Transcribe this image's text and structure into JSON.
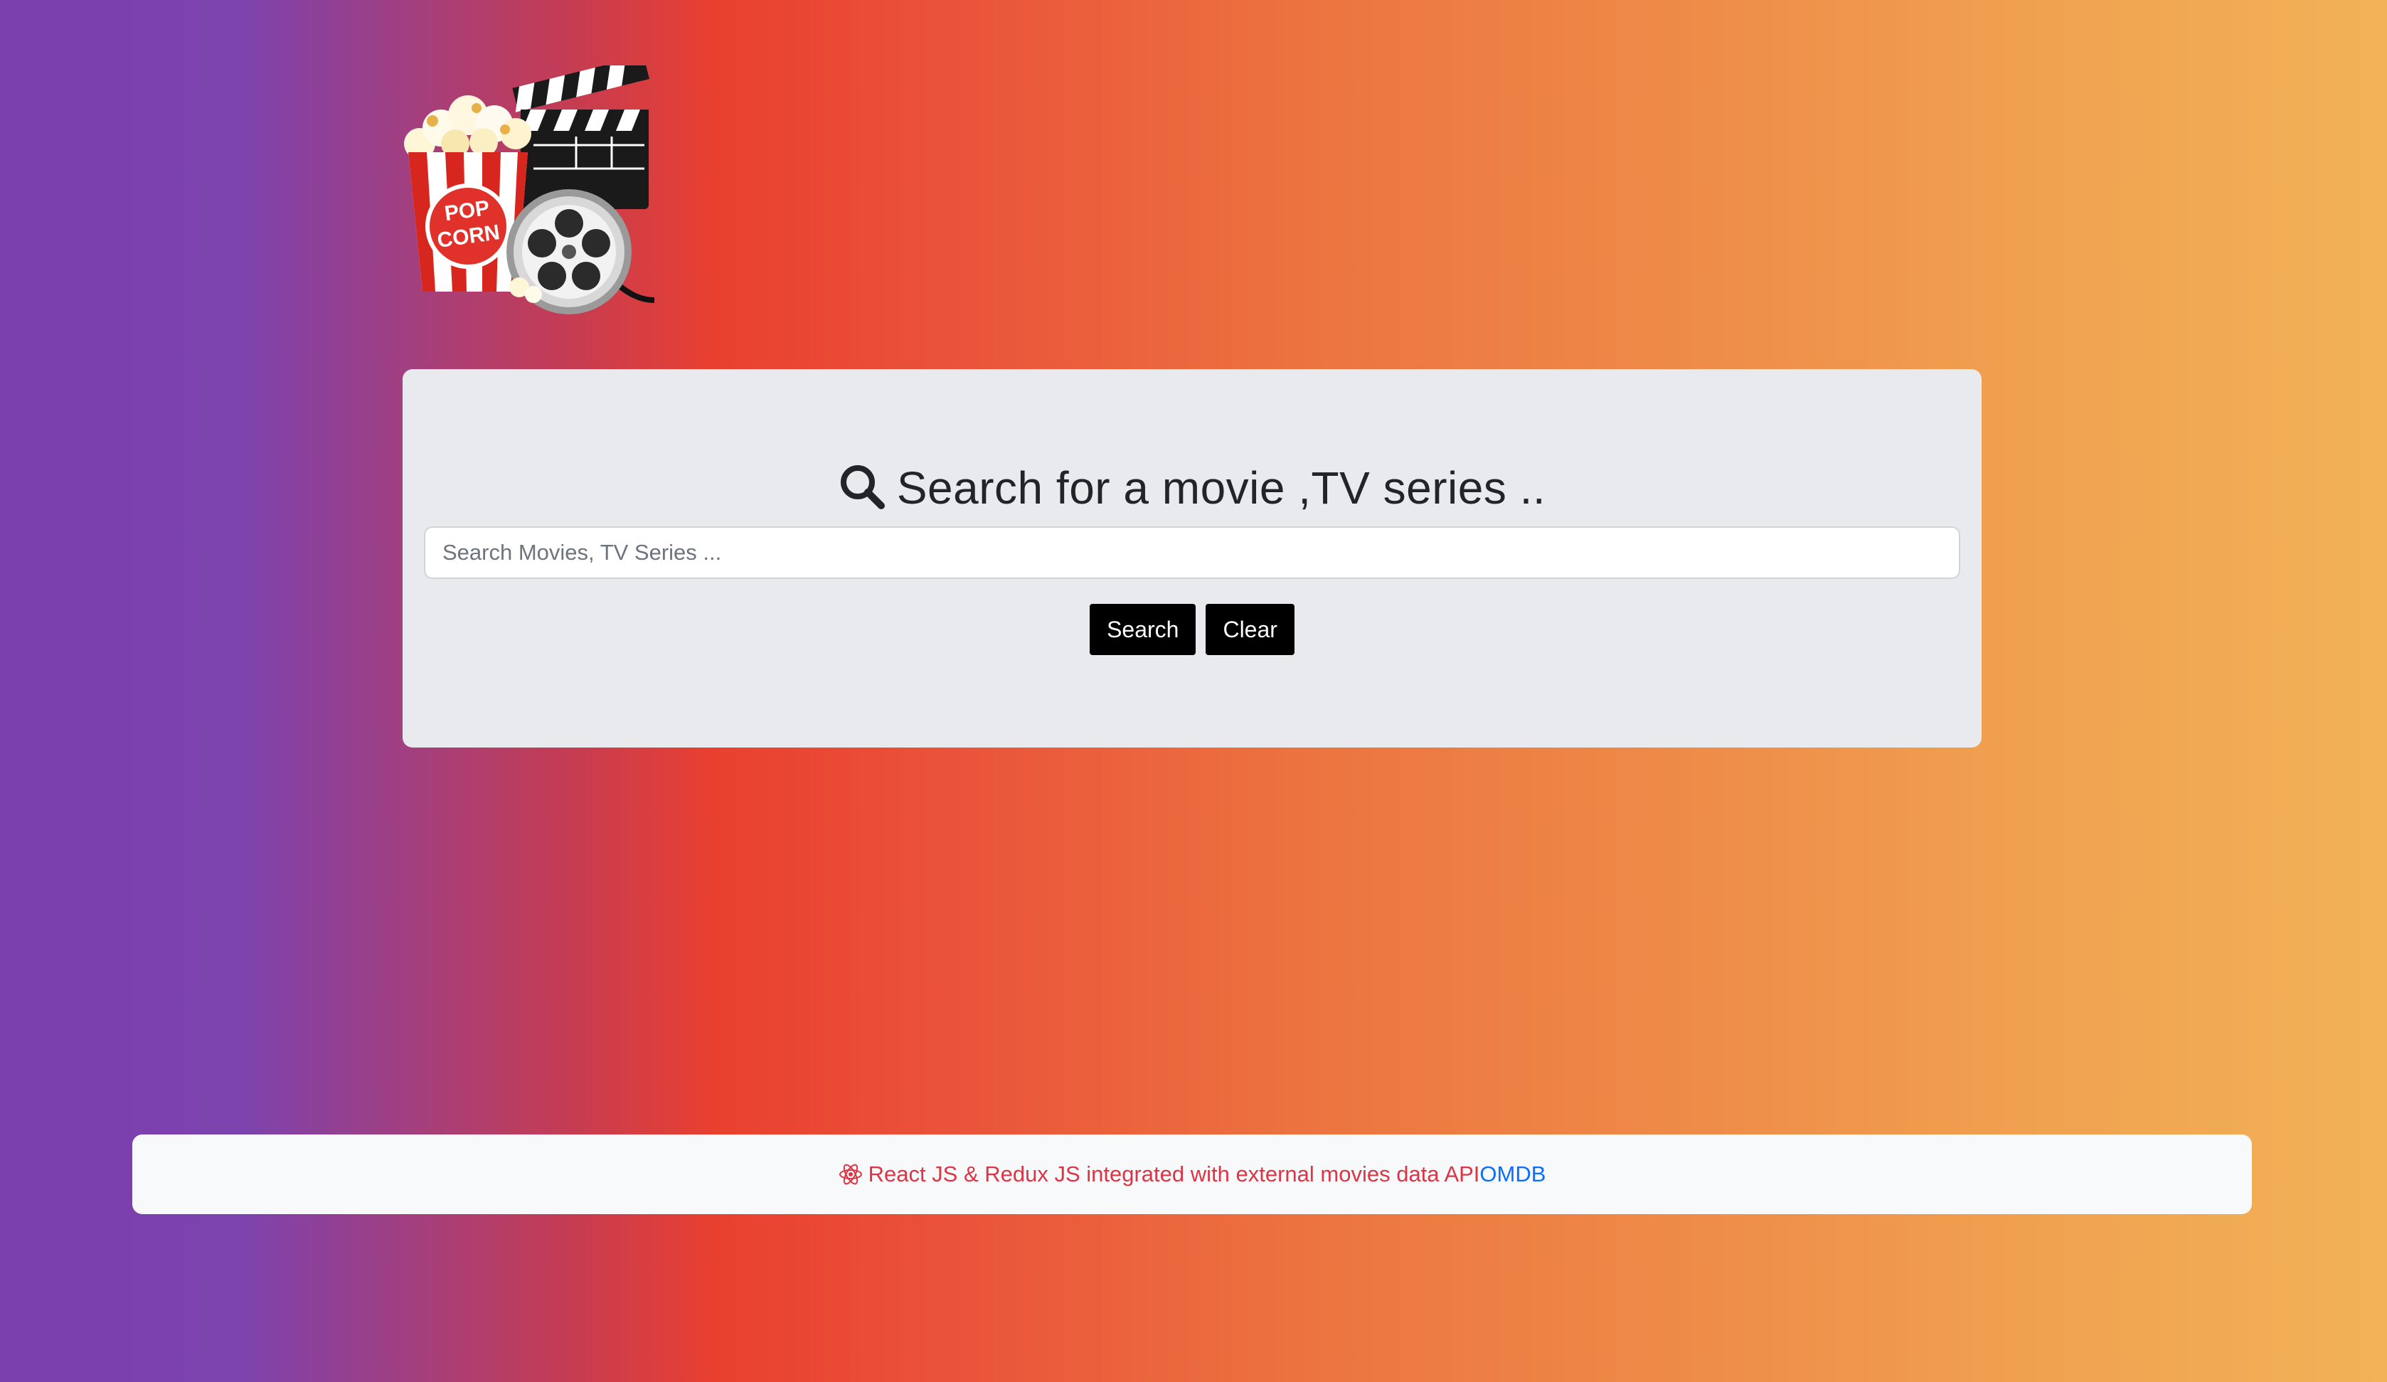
{
  "logo": {
    "icon": "popcorn-clapperboard-film-reel-logo",
    "text": "POP CORN"
  },
  "search": {
    "heading": "Search for a movie ,TV series ..",
    "heading_icon": "search-icon",
    "placeholder": "Search Movies, TV Series ...",
    "value": "",
    "search_label": "Search",
    "clear_label": "Clear"
  },
  "footer": {
    "icon": "react-icon",
    "text": "React JS & Redux JS integrated with external movies data API",
    "link_label": "OMDB"
  },
  "colors": {
    "gradient": [
      "#7c3fae",
      "#e9402f",
      "#f2b257"
    ],
    "card_bg": "#e9eaed",
    "footer_bg": "#f8f9fa",
    "footer_text": "#dc3545",
    "link": "#0d6efd",
    "button_bg": "#000000"
  }
}
